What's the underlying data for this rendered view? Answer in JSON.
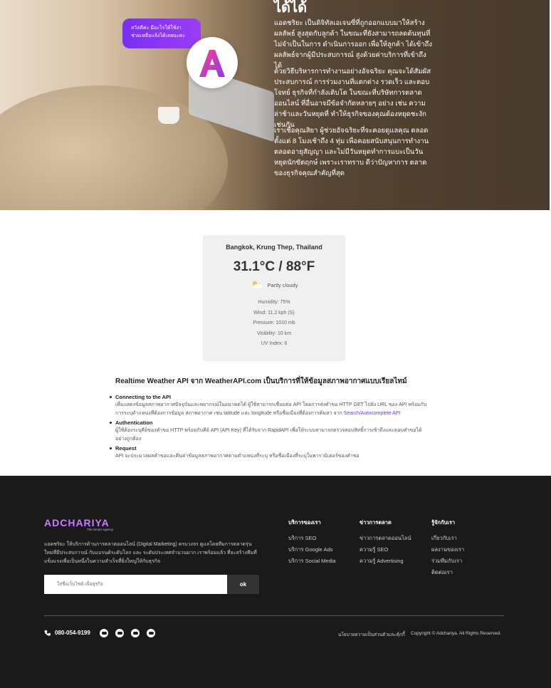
{
  "hero": {
    "title": "ได้ได้",
    "bubble": {
      "line1": "สวัสดีค่ะ มีอะไรให้ใช้งา",
      "line2": "ช่วยเหลือแจ้งได้เลยนะคะ"
    },
    "p1": "แอดชริยะ เป็นดิจิทัลเอเจนซี่ที่ถูกออกแบบมาให้สร้างผลลัพธ์ สูงสุดกับลูกค้า ในขณะที่ยังสามารถลดต้นทุนที่ไม่จำเป็นในการ ดำเนินการออก เพื่อให้ลูกค้า ได้เข้าถึงผลลัพธ์จากผู้มีประสบการณ์ สูงด้วยค่าบริการที่เข้าถึงได้",
    "p2": "ด้วยวิธีบริหารการทำงานอย่างอัจฉริยะ คุณจะได้สัมผัสประสบการณ์ การร่วมงานที่แตกต่าง รวดเร็ว และตอบโจทย์ ธุรกิจที่กำลังเติบโต ในขณะที่บริษัทการตลาดออนไลน์ ที่อื่นอาจมีข้อจำกัดหลายๆ อย่าง เช่น ความล่าช้าและวันหยุดที่ ทำให้ธุรกิจของคุณต้องหยุดชะงักเช่นกัน",
    "p3": "เราเชื่อคุณสิยา ผู้ช่วยอัจฉริยะที่จะคอยดูแลคุณ ตลอดตั้งแต่ 8 โมงเช้าถึง 4 ทุ่ม เพื่อคอยสนับสนุนการทำงานตลอดอายุสัญญา และไม่มีวันหยุดทำการแบะเป็นวันหยุดนักขัตฤกษ์ เพราะเราทราบ ดีว่าปัญหาการ ตลาดของธุรกิจคุณสำคัญที่สุด"
  },
  "weather": {
    "location": "Bangkok, Krung Thep, Thailand",
    "temperature": "31.1°C / 88°F",
    "condition": "Partly cloudy",
    "condition_icon": "partly-cloudy-icon",
    "humidity": "Humidity: 75%",
    "wind": "Wind: 11.2 kph (S)",
    "pressure": "Pressure: 1010 mb",
    "visibility": "Visibility: 10 km",
    "uv": "UV Index: 6"
  },
  "api": {
    "title": "Realtime Weather API จาก WeatherAPI.com เป็นบริการที่ให้ข้อมูลสภาพอากาศแบบเรียลไทม์",
    "items": [
      {
        "heading": "Connecting to the API",
        "desc": "เพื่อแสดงข้อมูลสภาพอากาศปัจจุบันและพยากรณ์ในอนาคตได้ ผู้ใช้สามารถเชื่อมต่อ API โดยการส่งคำขอ HTTP GET ไปยัง URL ของ API พร้อมกับการระบุตำแหน่งที่ต้องการข้อมูล สภาพอากาศ เช่น latitude และ longitude หรือชื่อเมืองที่ต้องการค้นหา จาก",
        "link": "Search/Autocomplete API"
      },
      {
        "heading": "Authentication",
        "desc": "ผู้ใช้ต้องระบุคีย์ของคำขอ HTTP พร้อมกับคีย์ API (API Key) ที่ได้รับจาก RapidAPI เพื่อให้ระบบสามารถตรวจสอบสิทธิ์การเข้าถึงและตอบคำขอได้อย่างถูกต้อง"
      },
      {
        "heading": "Request",
        "desc": "API จะประมวลผลคำขอและคืนค่าข้อมูลสภาพอากาศตามตำแหน่งที่ระบุ หรือชื่อเมืองที่ระบุในพารามิเตอร์ของคำขอ"
      }
    ]
  },
  "footer": {
    "logo": "ADCHARIYA",
    "logo_accent": "ADCHARIYA",
    "logo_tag": "The Smart Agency",
    "description": "แอดชริยะ ให้บริการด้านการตลาดออนไลน์ (Digital Marketing) ครบวงจร ดูแลโดยทีมการตลาดรุ่นใหม่ที่มีประสบการณ์ กับแบรนด์ระดับโลก และ ระดับประเทศจำนวนมาก เราพร้อมแล้ว ที่จะสร้างทีมที่แข็งแรงเพื่อเป็นหนึ่งในความสำเร็จที่ยิ่งใหญ่ให้กับธุรกิจ",
    "input_placeholder": "ใส่ชื่อเว็บไซต์ เพื่อธุรกิจ",
    "submit_label": "ok",
    "columns": [
      {
        "heading": "บริการของเรา",
        "items": [
          "บริการ SEO",
          "บริการ Google Ads",
          "บริการ Social Media"
        ]
      },
      {
        "heading": "ข่าวการตลาด",
        "items": [
          "ข่าวการตลาดออนไลน์",
          "ความรู้ SEO",
          "ความรู้ Advertising"
        ]
      },
      {
        "heading": "รู้จักกับเรา",
        "items": [
          "เกี่ยวกับเรา",
          "ผลงานของเรา",
          "ร่วมทีมกับเรา",
          "ติดต่อเรา"
        ]
      }
    ],
    "phone": "080-054-9199",
    "policy": "นโยบายความเป็นส่วนตัวและคุ้กกี้",
    "copyright": "Copyright © Adchariya. All Rights Reserved."
  }
}
